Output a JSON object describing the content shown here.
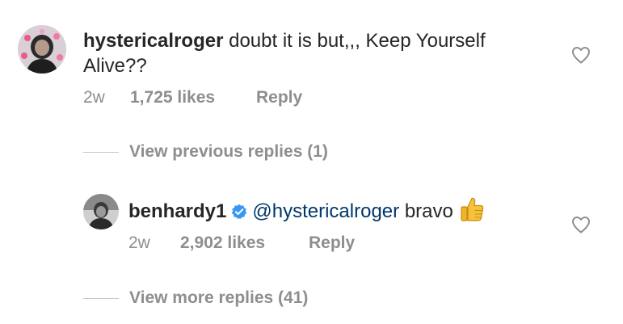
{
  "comments": [
    {
      "username": "hystericalroger",
      "text": "doubt it is but,,, Keep Yourself Alive??",
      "age": "2w",
      "likes": "1,725 likes",
      "reply_label": "Reply",
      "avatar_icon": "profile-photo-hearts"
    }
  ],
  "thread": {
    "previous_replies_label": "View previous replies (1)",
    "reply": {
      "username": "benhardy1",
      "verified": true,
      "mention": "@hystericalroger",
      "text": "bravo",
      "emoji": "👍",
      "age": "2w",
      "likes": "2,902 likes",
      "reply_label": "Reply",
      "avatar_icon": "profile-photo"
    },
    "more_replies_label": "View more replies (41)"
  },
  "icons": {
    "like": "heart-outline-icon",
    "verified": "verified-badge-icon"
  },
  "colors": {
    "text": "#262626",
    "secondary": "#8e8e8e",
    "mention": "#00376b",
    "verified": "#3897f0"
  }
}
